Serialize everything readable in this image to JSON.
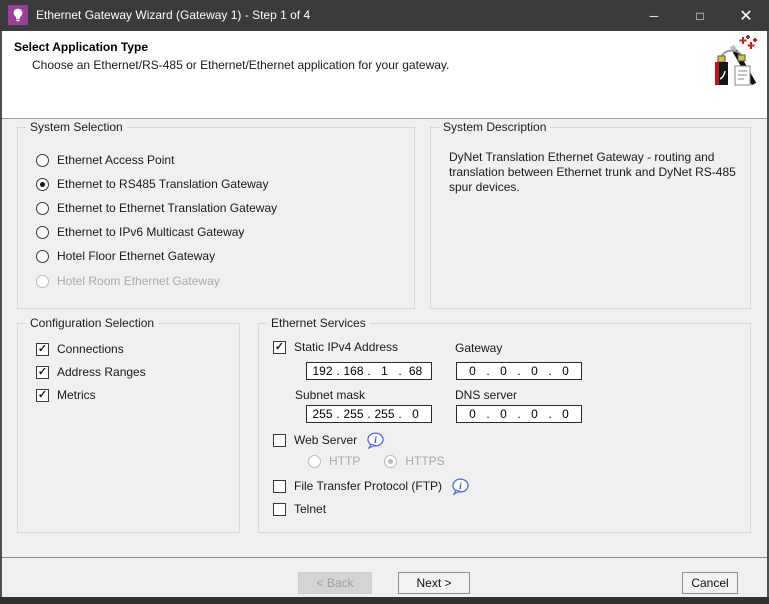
{
  "colors": {
    "title_bar": "#3b3b3b",
    "app_icon_purple": "#9c3f98",
    "body_bg": "#f0f0f0",
    "header_bg": "#ffffff",
    "info_blue": "#3a5dc8"
  },
  "glyphs": {
    "check": "✓"
  },
  "window": {
    "title": "Ethernet Gateway Wizard (Gateway 1) - Step 1 of 4",
    "minimize_glyph": "─",
    "maximize_glyph": "□",
    "close_glyph": "✕"
  },
  "header": {
    "title": "Select Application Type",
    "subtitle": "Choose an Ethernet/RS-485 or Ethernet/Ethernet application for your gateway."
  },
  "system_selection": {
    "label": "System Selection",
    "options": [
      {
        "label": "Ethernet Access Point",
        "selected": false,
        "enabled": true
      },
      {
        "label": "Ethernet to RS485 Translation Gateway",
        "selected": true,
        "enabled": true
      },
      {
        "label": "Ethernet to Ethernet Translation Gateway",
        "selected": false,
        "enabled": true
      },
      {
        "label": "Ethernet to IPv6 Multicast Gateway",
        "selected": false,
        "enabled": true
      },
      {
        "label": "Hotel Floor Ethernet Gateway",
        "selected": false,
        "enabled": true
      },
      {
        "label": "Hotel Room Ethernet Gateway",
        "selected": false,
        "enabled": false
      }
    ]
  },
  "system_description": {
    "label": "System Description",
    "text": "DyNet Translation Ethernet Gateway - routing and translation between Ethernet trunk and DyNet RS-485 spur devices."
  },
  "configuration_selection": {
    "label": "Configuration Selection",
    "items": [
      {
        "label": "Connections",
        "checked": true
      },
      {
        "label": "Address Ranges",
        "checked": true
      },
      {
        "label": "Metrics",
        "checked": true
      }
    ]
  },
  "ethernet_services": {
    "label": "Ethernet Services",
    "static_ipv4": {
      "label": "Static IPv4 Address",
      "checked": true
    },
    "gateway_label": "Gateway",
    "subnet_label": "Subnet mask",
    "dns_label": "DNS server",
    "ip_separator": ".",
    "ipv4": [
      "192",
      "168",
      "1",
      "68"
    ],
    "gateway": [
      "0",
      "0",
      "0",
      "0"
    ],
    "subnet": [
      "255",
      "255",
      "255",
      "0"
    ],
    "dns": [
      "0",
      "0",
      "0",
      "0"
    ],
    "web_server": {
      "label": "Web Server",
      "checked": false
    },
    "http": {
      "label": "HTTP",
      "selected": false,
      "enabled": false
    },
    "https": {
      "label": "HTTPS",
      "selected": true,
      "enabled": false
    },
    "ftp": {
      "label": "File Transfer Protocol (FTP)",
      "checked": false
    },
    "telnet": {
      "label": "Telnet",
      "checked": false
    }
  },
  "footer": {
    "back": "< Back",
    "next": "Next >",
    "cancel": "Cancel"
  }
}
